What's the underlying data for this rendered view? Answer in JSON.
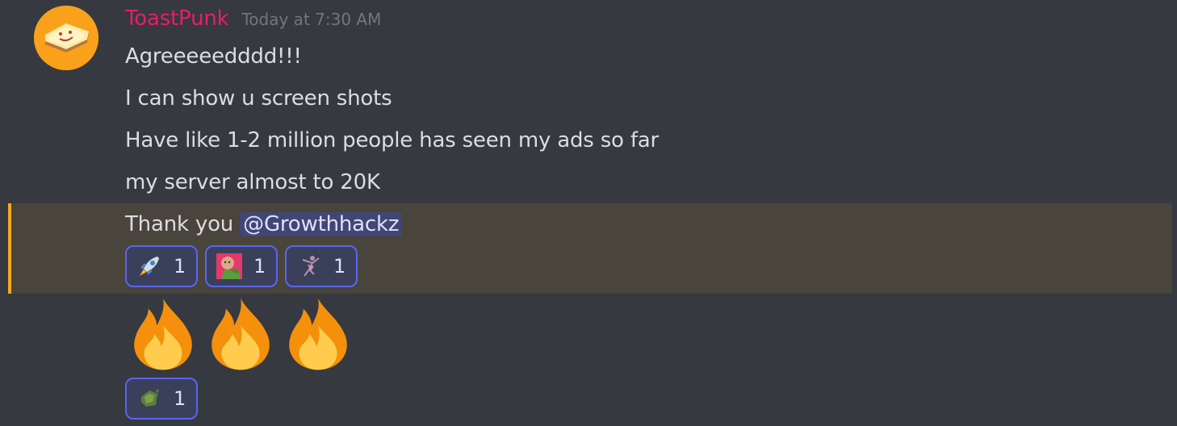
{
  "message": {
    "author": "ToastPunk",
    "author_color": "#e91e63",
    "timestamp": "Today at 7:30 AM",
    "avatar_icon": "toast-icon",
    "lines": [
      "Agreeeeedddd!!!",
      "I can show u screen shots",
      "Have like 1-2 million people has seen my ads so far",
      "my server almost to 20K"
    ],
    "highlighted_line": {
      "text": "Thank you ",
      "mention": "@Growthhackz"
    },
    "highlight_color": "#faa81a"
  },
  "reactions_1": [
    {
      "emoji": "rocket-icon",
      "count": "1"
    },
    {
      "emoji": "custom-character-emoji",
      "count": "1"
    },
    {
      "emoji": "custom-dancer-emoji",
      "count": "1"
    }
  ],
  "big_emoji": [
    "fire-icon",
    "fire-icon",
    "fire-icon"
  ],
  "reactions_2": [
    {
      "emoji": "custom-green-emoji",
      "count": "1"
    }
  ],
  "colors": {
    "background": "#36393f",
    "reaction_border": "#5865f2",
    "mention_bg": "#414675"
  }
}
